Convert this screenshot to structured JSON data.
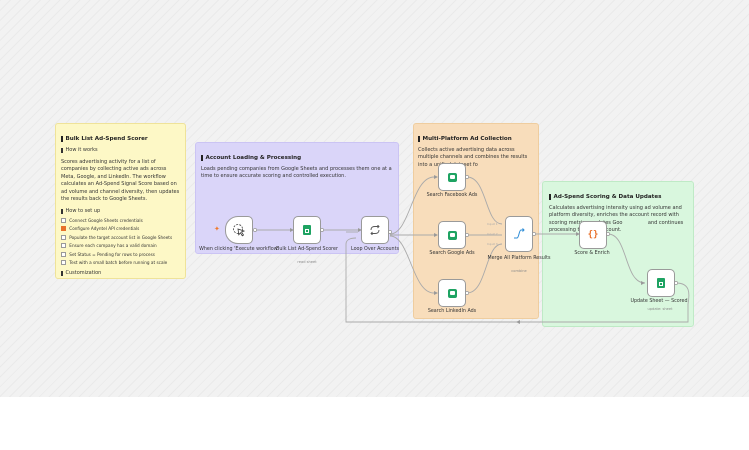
{
  "notes": {
    "main": {
      "title": "Bulk List Ad-Spend Scorer",
      "how_heading": "How it works",
      "description": "Scores advertising activity for a list of companies by collecting active ads across Meta, Google, and LinkedIn. The workflow calculates an Ad-Spend Signal Score based on ad volume and channel diversity, then updates the results back to Google Sheets.",
      "setup_heading": "How to set up",
      "setup_items": [
        {
          "text": "Connect Google Sheets credentials",
          "checked": false
        },
        {
          "text": "Configure Adyntel API credentials",
          "checked": true
        },
        {
          "text": "Populate the target account list in Google Sheets",
          "checked": false
        },
        {
          "text": "Ensure each company has a valid domain",
          "checked": false
        },
        {
          "text": "Set Status = Pending for rows to process",
          "checked": false
        },
        {
          "text": "Test with a small batch before running at scale",
          "checked": false
        }
      ],
      "customization_heading": "Customization"
    },
    "loading": {
      "title": "Account Loading & Processing",
      "description": "Loads pending companies from Google Sheets and processes them one at a time to ensure accurate scoring and controlled execution."
    },
    "collection": {
      "title": "Multi-Platform Ad Collection",
      "description": "Collects active advertising data across multiple channels and combines the results into a unified dataset fo"
    },
    "scoring": {
      "title": "Ad-Spend Scoring & Data Updates",
      "description": "Calculates advertising intensity using ad volume and platform diversity, enriches the account record with scoring metrics, updates Goo                and continues processing the next account."
    }
  },
  "nodes": {
    "trigger": {
      "label": "When clicking 'Execute workflow'",
      "icon": "cursor-click-icon"
    },
    "sheet_load": {
      "label": "Bulk List Ad-Spend Scorer",
      "sub": "read sheet",
      "icon": "google-sheets-icon"
    },
    "loop": {
      "label": "Loop Over Accounts",
      "icon": "loop-icon"
    },
    "facebook": {
      "label": "Search Facebook Ads",
      "icon": "adyntel-icon"
    },
    "google": {
      "label": "Search Google Ads",
      "icon": "adyntel-icon"
    },
    "linkedin": {
      "label": "Search LinkedIn Ads",
      "icon": "adyntel-icon"
    },
    "merge": {
      "label": "Merge All Platform Results",
      "sub": "combine",
      "icon": "merge-icon",
      "inputs": [
        "Input 1",
        "Input 2",
        "Input 3"
      ]
    },
    "score": {
      "label": "Score & Enrich",
      "icon": "code-braces-icon"
    },
    "update": {
      "label": "Update Sheet — Scored",
      "sub": "update: sheet",
      "icon": "google-sheets-icon"
    }
  },
  "colors": {
    "note_yellow": "#fdf8c6",
    "note_purple": "#dad5f9",
    "note_orange": "#f8ddbb",
    "note_green": "#d9f7de",
    "trigger_accent": "#f07a2a",
    "sheets_green": "#1ea362"
  }
}
